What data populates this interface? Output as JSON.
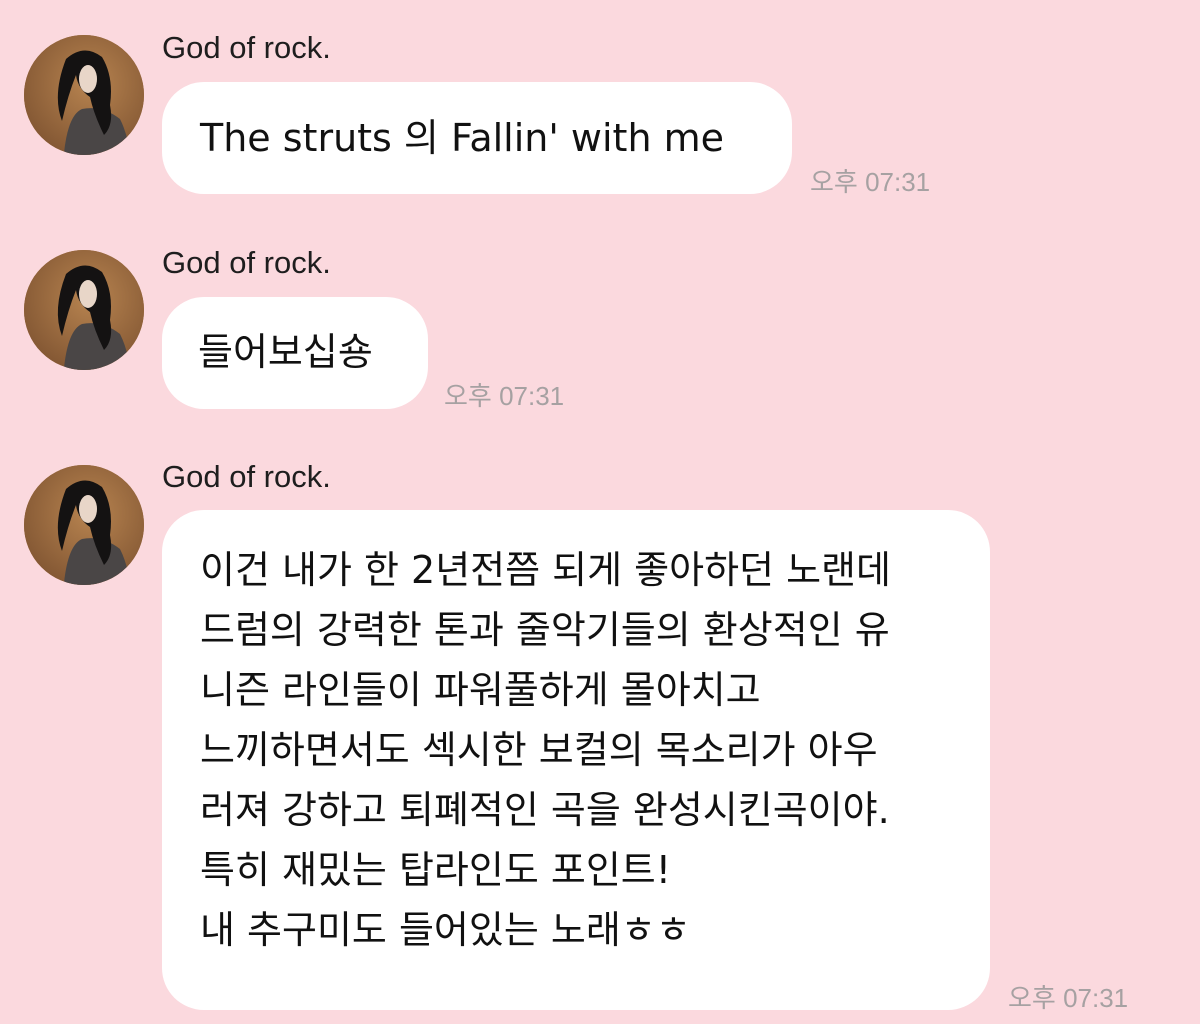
{
  "colors": {
    "background": "#fbd9de",
    "bubble": "#ffffff",
    "timestamp": "#a6a1a2"
  },
  "messages": [
    {
      "sender": "God of rock.",
      "avatar_icon": "profile-photo",
      "lines": [
        "The struts 의 Fallin' with me"
      ],
      "time": "오후 07:31"
    },
    {
      "sender": "God of rock.",
      "avatar_icon": "profile-photo",
      "lines": [
        "들어보십숑"
      ],
      "time": "오후 07:31"
    },
    {
      "sender": "God of rock.",
      "avatar_icon": "profile-photo",
      "lines": [
        "이건 내가 한 2년전쯤 되게 좋아하던 노랜데",
        "드럼의 강력한 톤과 줄악기들의 환상적인 유",
        "니즌 라인들이 파워풀하게 몰아치고",
        "느끼하면서도 섹시한 보컬의 목소리가 아우",
        "러져 강하고 퇴폐적인 곡을 완성시킨곡이야.",
        "특히 재밌는 탑라인도 포인트!",
        "내 추구미도 들어있는 노래ㅎㅎ"
      ],
      "time": "오후 07:31"
    }
  ]
}
